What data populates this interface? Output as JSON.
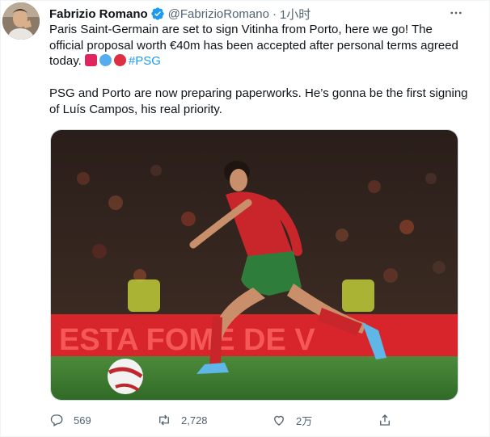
{
  "author": {
    "name": "Fabrizio Romano",
    "handle": "@FabrizioRomano",
    "separator": "·",
    "time": "1小时"
  },
  "tweet": {
    "line1": "Paris Saint-Germain are set to sign Vitinha from Porto, here we go! The official proposal worth €40m has been accepted after personal terms agreed today.",
    "hashtag": "#PSG",
    "line2": "PSG and Porto are now preparing paperworks. He’s gonna be the first signing of Luís Campos, his real priority."
  },
  "media": {
    "board_text": "ESTA FOME DE V"
  },
  "actions": {
    "replies": "569",
    "retweets": "2,728",
    "likes": "2万"
  },
  "colors": {
    "accent": "#1d9bf0",
    "muted": "#536471",
    "pitch": "#3b7a2f",
    "board": "#d8252b"
  }
}
